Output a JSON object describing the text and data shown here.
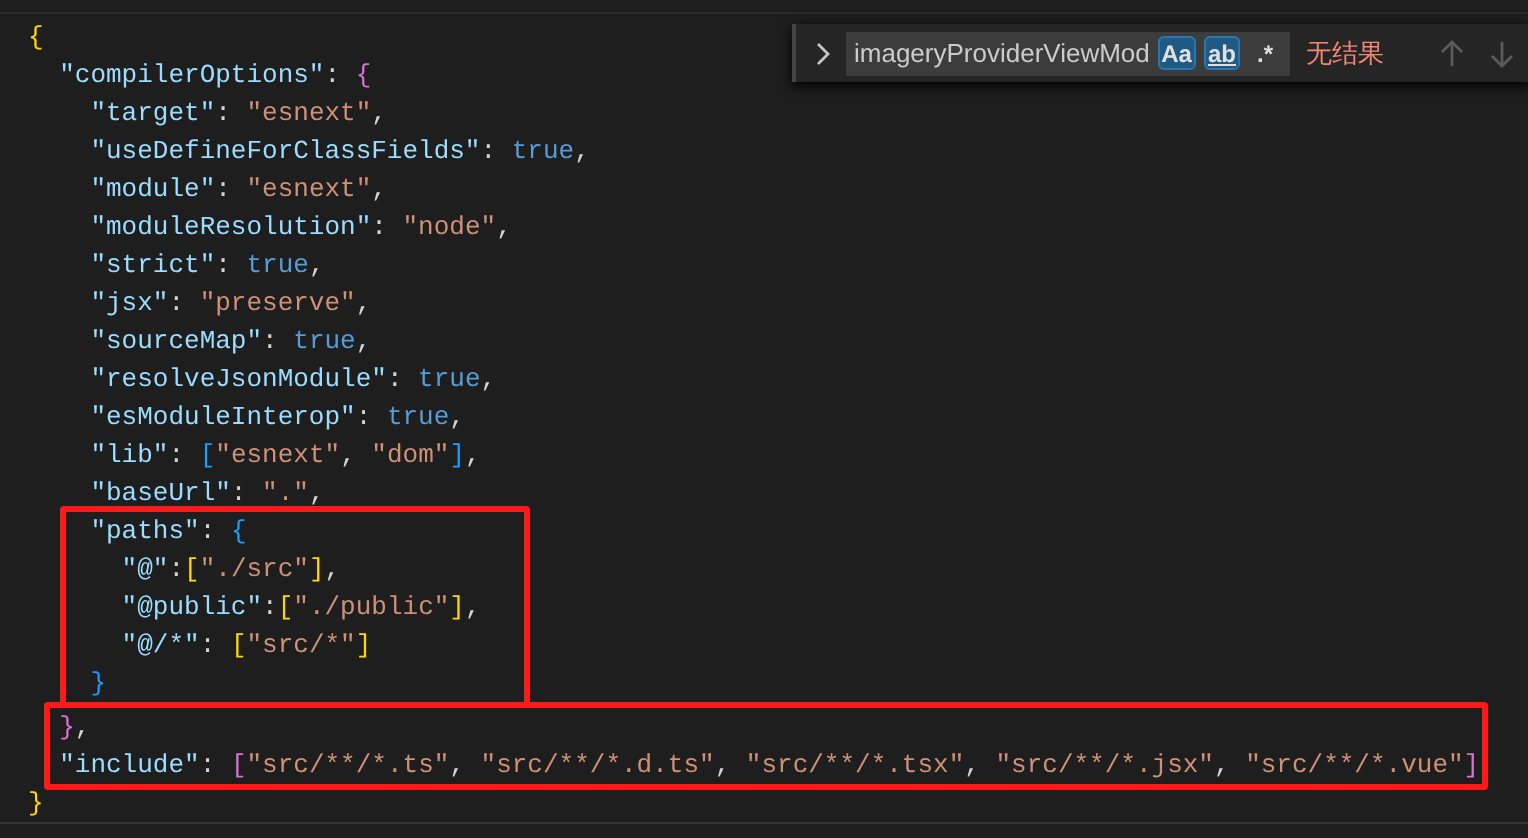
{
  "find_widget": {
    "expanded": false,
    "value": "imageryProviderViewMod",
    "toggles": [
      {
        "label": "Aa",
        "kind": "case",
        "selected": true
      },
      {
        "label": "ab",
        "kind": "word",
        "selected": true
      },
      {
        "label": ".*",
        "kind": "regex",
        "selected": false
      }
    ],
    "result": "无结果",
    "nav_disabled": true
  },
  "editor": {
    "blocks": [
      {
        "kind": "plain",
        "lines": [
          [
            {
              "kind": "bracket",
              "t": "{",
              "color": "#ffd700"
            }
          ],
          [
            {
              "kind": "key",
              "t": "  \"compilerOptions\""
            },
            {
              "kind": "punct",
              "t": ": "
            },
            {
              "kind": "bracket",
              "t": "{",
              "color": "#da70d6"
            }
          ],
          [
            {
              "kind": "key",
              "t": "    \"target\""
            },
            {
              "kind": "punct",
              "t": ": "
            },
            {
              "kind": "str",
              "t": "\"esnext\""
            },
            {
              "kind": "punct",
              "t": ","
            }
          ],
          [
            {
              "kind": "key",
              "t": "    \"useDefineForClassFields\""
            },
            {
              "kind": "punct",
              "t": ": "
            },
            {
              "kind": "bool",
              "t": "true"
            },
            {
              "kind": "punct",
              "t": ","
            }
          ],
          [
            {
              "kind": "key",
              "t": "    \"module\""
            },
            {
              "kind": "punct",
              "t": ": "
            },
            {
              "kind": "str",
              "t": "\"esnext\""
            },
            {
              "kind": "punct",
              "t": ","
            }
          ],
          [
            {
              "kind": "key",
              "t": "    \"moduleResolution\""
            },
            {
              "kind": "punct",
              "t": ": "
            },
            {
              "kind": "str",
              "t": "\"node\""
            },
            {
              "kind": "punct",
              "t": ","
            }
          ],
          [
            {
              "kind": "key",
              "t": "    \"strict\""
            },
            {
              "kind": "punct",
              "t": ": "
            },
            {
              "kind": "bool",
              "t": "true"
            },
            {
              "kind": "punct",
              "t": ","
            }
          ],
          [
            {
              "kind": "key",
              "t": "    \"jsx\""
            },
            {
              "kind": "punct",
              "t": ": "
            },
            {
              "kind": "str",
              "t": "\"preserve\""
            },
            {
              "kind": "punct",
              "t": ","
            }
          ],
          [
            {
              "kind": "key",
              "t": "    \"sourceMap\""
            },
            {
              "kind": "punct",
              "t": ": "
            },
            {
              "kind": "bool",
              "t": "true"
            },
            {
              "kind": "punct",
              "t": ","
            }
          ],
          [
            {
              "kind": "key",
              "t": "    \"resolveJsonModule\""
            },
            {
              "kind": "punct",
              "t": ": "
            },
            {
              "kind": "bool",
              "t": "true"
            },
            {
              "kind": "punct",
              "t": ","
            }
          ],
          [
            {
              "kind": "key",
              "t": "    \"esModuleInterop\""
            },
            {
              "kind": "punct",
              "t": ": "
            },
            {
              "kind": "bool",
              "t": "true"
            },
            {
              "kind": "punct",
              "t": ","
            }
          ],
          [
            {
              "kind": "key",
              "t": "    \"lib\""
            },
            {
              "kind": "punct",
              "t": ": "
            },
            {
              "kind": "bracket",
              "t": "[",
              "color": "#179fff"
            },
            {
              "kind": "str",
              "t": "\"esnext\""
            },
            {
              "kind": "punct",
              "t": ", "
            },
            {
              "kind": "str",
              "t": "\"dom\""
            },
            {
              "kind": "bracket",
              "t": "]",
              "color": "#179fff"
            },
            {
              "kind": "punct",
              "t": ","
            }
          ],
          [
            {
              "kind": "key",
              "t": "    \"baseUrl\""
            },
            {
              "kind": "punct",
              "t": ": "
            },
            {
              "kind": "str",
              "t": "\".\""
            },
            {
              "kind": "punct",
              "t": ","
            }
          ]
        ]
      },
      {
        "kind": "highlight",
        "lines": [
          [
            {
              "kind": "key",
              "t": "    \"paths\""
            },
            {
              "kind": "punct",
              "t": ": "
            },
            {
              "kind": "bracket",
              "t": "{",
              "color": "#179fff"
            }
          ],
          [
            {
              "kind": "key",
              "t": "      \"@\""
            },
            {
              "kind": "punct",
              "t": ":"
            },
            {
              "kind": "bracket",
              "t": "[",
              "color": "#ffd700"
            },
            {
              "kind": "str",
              "t": "\"./src\""
            },
            {
              "kind": "bracket",
              "t": "]",
              "color": "#ffd700"
            },
            {
              "kind": "punct",
              "t": ","
            }
          ],
          [
            {
              "kind": "key",
              "t": "      \"@public\""
            },
            {
              "kind": "punct",
              "t": ":"
            },
            {
              "kind": "bracket",
              "t": "[",
              "color": "#ffd700"
            },
            {
              "kind": "str",
              "t": "\"./public\""
            },
            {
              "kind": "bracket",
              "t": "]",
              "color": "#ffd700"
            },
            {
              "kind": "punct",
              "t": ","
            }
          ],
          [
            {
              "kind": "key",
              "t": "      \"@/*\""
            },
            {
              "kind": "punct",
              "t": ": "
            },
            {
              "kind": "bracket",
              "t": "[",
              "color": "#ffd700"
            },
            {
              "kind": "str",
              "t": "\"src/*\""
            },
            {
              "kind": "bracket",
              "t": "]",
              "color": "#ffd700"
            }
          ],
          [
            {
              "kind": "bracket",
              "t": "    }",
              "color": "#179fff"
            }
          ]
        ]
      },
      {
        "kind": "highlight",
        "lines": [
          [
            {
              "kind": "bracket",
              "t": "  }",
              "color": "#da70d6"
            },
            {
              "kind": "punct",
              "t": ","
            }
          ],
          [
            {
              "kind": "key",
              "t": "  \"include\""
            },
            {
              "kind": "punct",
              "t": ": "
            },
            {
              "kind": "bracket",
              "t": "[",
              "color": "#da70d6"
            },
            {
              "kind": "str",
              "t": "\"src/**/*.ts\""
            },
            {
              "kind": "punct",
              "t": ", "
            },
            {
              "kind": "str",
              "t": "\"src/**/*.d.ts\""
            },
            {
              "kind": "punct",
              "t": ", "
            },
            {
              "kind": "str",
              "t": "\"src/**/*.tsx\""
            },
            {
              "kind": "punct",
              "t": ", "
            },
            {
              "kind": "str",
              "t": "\"src/**/*.jsx\""
            },
            {
              "kind": "punct",
              "t": ", "
            },
            {
              "kind": "str",
              "t": "\"src/**/*.vue\""
            },
            {
              "kind": "bracket",
              "t": "]",
              "color": "#da70d6"
            }
          ]
        ]
      },
      {
        "kind": "plain",
        "lines": [
          [
            {
              "kind": "bracket",
              "t": "}",
              "color": "#ffd700"
            }
          ]
        ]
      }
    ]
  }
}
